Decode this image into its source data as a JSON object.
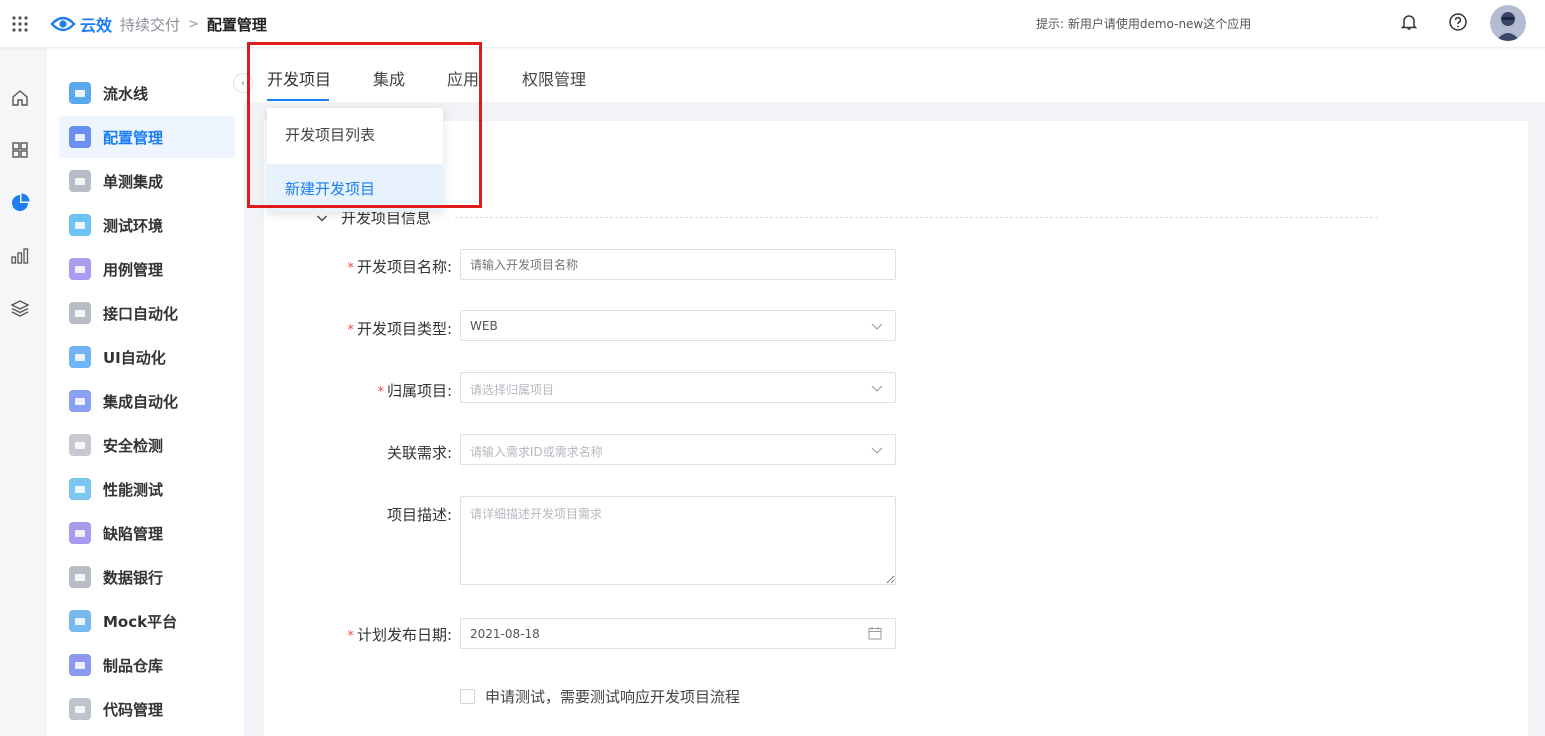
{
  "header": {
    "logo_text": "云效",
    "breadcrumb_parent": "持续交付",
    "breadcrumb_separator": ">",
    "breadcrumb_current": "配置管理",
    "hint": "提示: 新用户请使用demo-new这个应用",
    "brand_color": "#1b7ef2"
  },
  "rail": {
    "icons": [
      "home-icon",
      "grid-icon",
      "pie-chart-icon",
      "bar-chart-icon",
      "layers-icon"
    ],
    "active_icon": "pie-chart-icon"
  },
  "sidebar": {
    "items": [
      {
        "label": "流水线",
        "color": "#5aa9ef"
      },
      {
        "label": "配置管理",
        "color": "#6b8ff0"
      },
      {
        "label": "单测集成",
        "color": "#b8bcc6"
      },
      {
        "label": "测试环境",
        "color": "#6fc2f5"
      },
      {
        "label": "用例管理",
        "color": "#a89df0"
      },
      {
        "label": "接口自动化",
        "color": "#b8bcc6"
      },
      {
        "label": "UI自动化",
        "color": "#6fb4f5"
      },
      {
        "label": "集成自动化",
        "color": "#8aa0f2"
      },
      {
        "label": "安全检测",
        "color": "#c6c9d0"
      },
      {
        "label": "性能测试",
        "color": "#7cc6f2"
      },
      {
        "label": "缺陷管理",
        "color": "#a79bef"
      },
      {
        "label": "数据银行",
        "color": "#b8bcc6"
      },
      {
        "label": "Mock平台",
        "color": "#7ab8f2"
      },
      {
        "label": "制品仓库",
        "color": "#8d98ef"
      },
      {
        "label": "代码管理",
        "color": "#bfc3cb"
      }
    ],
    "active_index": 1,
    "collapse_glyph": "‹"
  },
  "tabs": [
    {
      "label": "开发项目"
    },
    {
      "label": "集成"
    },
    {
      "label": "应用"
    },
    {
      "label": "权限管理"
    }
  ],
  "dropdown": {
    "items": [
      "开发项目列表",
      "新建开发项目"
    ],
    "hover_index": 1
  },
  "form": {
    "section_title": "开发项目信息",
    "name": {
      "label": "开发项目名称:",
      "required": true,
      "placeholder": "请输入开发项目名称",
      "value": ""
    },
    "type": {
      "label": "开发项目类型:",
      "required": true,
      "value": "WEB"
    },
    "project": {
      "label": "归属项目:",
      "required": true,
      "placeholder": "请选择归属项目"
    },
    "requirement": {
      "label": "关联需求:",
      "required": false,
      "placeholder": "请输入需求ID或需求名称"
    },
    "description": {
      "label": "项目描述:",
      "required": false,
      "placeholder": "请详细描述开发项目需求"
    },
    "release_date": {
      "label": "计划发布日期:",
      "required": true,
      "value": "2021-08-18"
    },
    "test_checkbox": {
      "label": "申请测试，需要测试响应开发项目流程",
      "checked": false
    },
    "required_mark": "*"
  }
}
